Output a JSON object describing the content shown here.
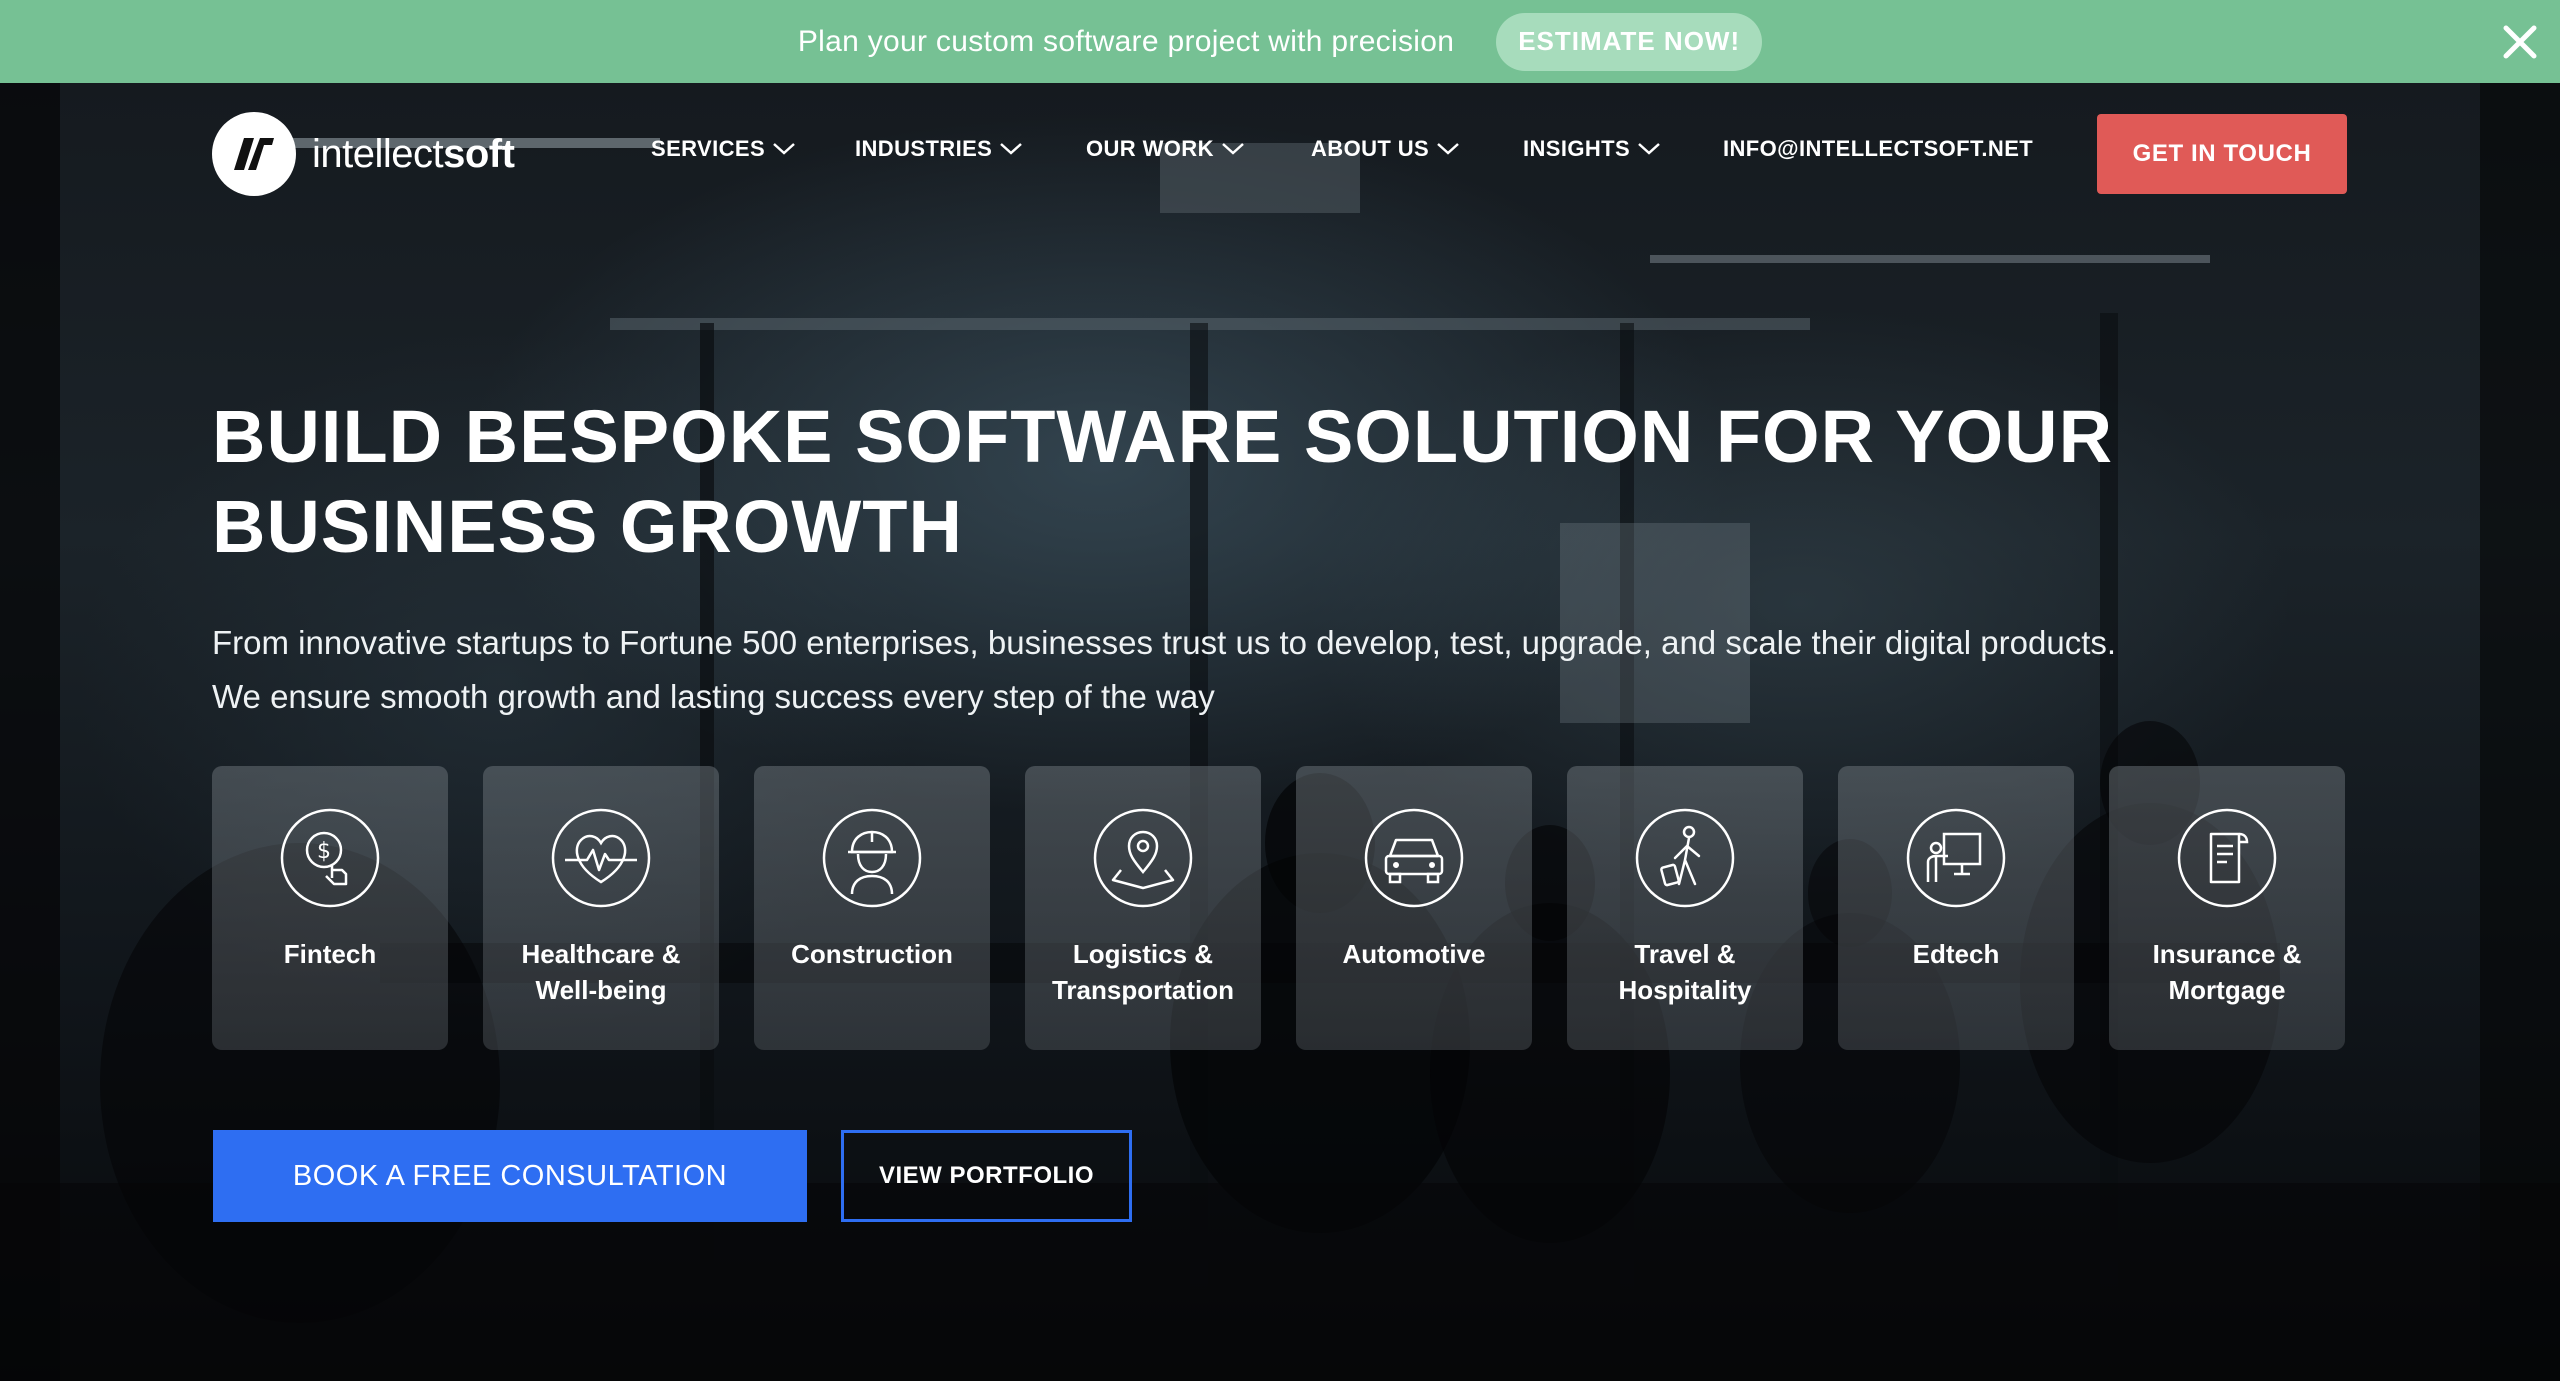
{
  "promo": {
    "text": "Plan your custom software project with precision",
    "button": "ESTIMATE NOW!",
    "background": "#76c194"
  },
  "logo": {
    "text_regular": "intellect",
    "text_bold": "soft"
  },
  "nav": {
    "items": [
      {
        "label": "SERVICES",
        "dropdown": true
      },
      {
        "label": "INDUSTRIES",
        "dropdown": true
      },
      {
        "label": "OUR WORK",
        "dropdown": true
      },
      {
        "label": "ABOUT US",
        "dropdown": true
      },
      {
        "label": "INSIGHTS",
        "dropdown": true
      }
    ],
    "email": "INFO@INTELLECTSOFT.NET",
    "cta": "GET IN TOUCH",
    "cta_color": "#e05a57"
  },
  "hero": {
    "headline_line1": "BUILD BESPOKE SOFTWARE SOLUTION FOR YOUR",
    "headline_line2": "BUSINESS GROWTH",
    "subtext_line1": "From innovative startups to Fortune 500 enterprises, businesses trust us to develop, test, upgrade, and scale their digital products.",
    "subtext_line2": "We ensure smooth growth and lasting success every step of the way"
  },
  "industries": [
    {
      "line1": "Fintech",
      "line2": "",
      "icon": "dollar-hand-icon"
    },
    {
      "line1": "Healthcare &",
      "line2": "Well-being",
      "icon": "heart-pulse-icon"
    },
    {
      "line1": "Construction",
      "line2": "",
      "icon": "hard-hat-worker-icon"
    },
    {
      "line1": "Logistics &",
      "line2": "Transportation",
      "icon": "map-pin-icon"
    },
    {
      "line1": "Automotive",
      "line2": "",
      "icon": "car-icon"
    },
    {
      "line1": "Travel &",
      "line2": "Hospitality",
      "icon": "traveler-luggage-icon"
    },
    {
      "line1": "Edtech",
      "line2": "",
      "icon": "teacher-board-icon"
    },
    {
      "line1": "Insurance &",
      "line2": "Mortgage",
      "icon": "document-icon"
    }
  ],
  "cta": {
    "primary": "BOOK A FREE CONSULTATION",
    "secondary": "VIEW PORTFOLIO",
    "accent": "#2e6ef2"
  }
}
